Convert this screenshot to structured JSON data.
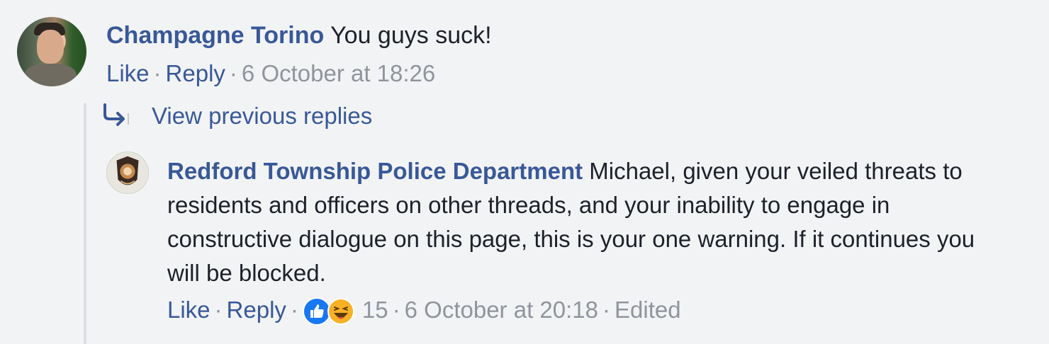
{
  "comment": {
    "author": "Champagne Torino",
    "text": "You guys suck!",
    "actions": {
      "like": "Like",
      "reply": "Reply",
      "timestamp": "6 October at 18:26"
    }
  },
  "thread": {
    "view_previous": "View previous replies"
  },
  "reply": {
    "author": "Redford Township Police Department",
    "text": "Michael, given your veiled threats to residents and officers on other threads, and your inability to engage in constructive dialogue on this page, this is your one warning. If it continues you will be blocked.",
    "actions": {
      "like": "Like",
      "reply": "Reply",
      "reaction_count": "15",
      "timestamp": "6 October at 20:18",
      "edited": "Edited"
    },
    "reactions": [
      "like-icon",
      "haha-icon"
    ]
  },
  "colors": {
    "background": "#f2f3f5",
    "link": "#385898",
    "meta": "#90949c",
    "text": "#1d2129",
    "like_blue": "#1877f2",
    "haha_yellow": "#f7b125",
    "thread_line": "#dadde1"
  },
  "separator": "·"
}
